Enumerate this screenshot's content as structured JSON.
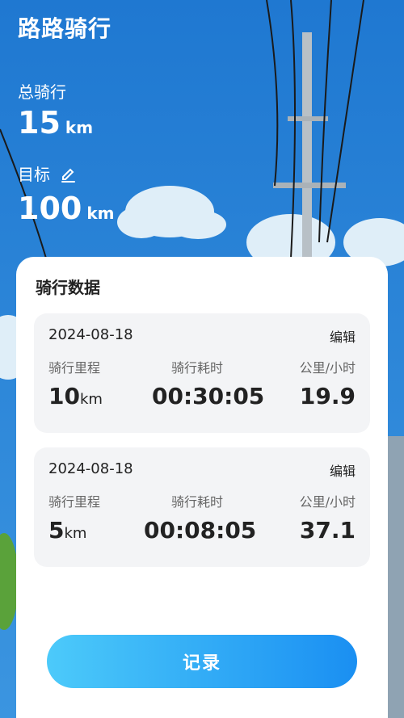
{
  "app": {
    "title": "路路骑行"
  },
  "stats": {
    "total_label": "总骑行",
    "total_value": "15",
    "total_unit": "km",
    "goal_label": "目标",
    "goal_value": "100",
    "goal_unit": "km"
  },
  "panel": {
    "title": "骑行数据",
    "column_labels": {
      "distance": "骑行里程",
      "duration": "骑行耗时",
      "speed": "公里/小时"
    },
    "edit_label": "编辑",
    "records": [
      {
        "date": "2024-08-18",
        "distance": "10",
        "distance_unit": "km",
        "duration": "00:30:05",
        "speed": "19.9"
      },
      {
        "date": "2024-08-18",
        "distance": "5",
        "distance_unit": "km",
        "duration": "00:08:05",
        "speed": "37.1"
      }
    ]
  },
  "record_button": {
    "label": "记录"
  },
  "icons": {
    "edit_goal": "pencil-icon"
  },
  "colors": {
    "sky": "#2a7fd3",
    "button_start": "#4ccafa",
    "button_end": "#1a8ff2"
  }
}
